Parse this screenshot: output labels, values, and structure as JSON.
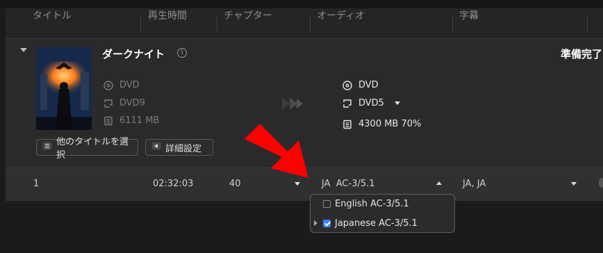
{
  "header": {
    "columns": [
      "タイトル",
      "再生時間",
      "チャプター",
      "オーディオ",
      "字幕"
    ]
  },
  "disc": {
    "title": "ダークナイト",
    "status": "準備完了",
    "source": {
      "type": "DVD",
      "format": "DVD9",
      "size": "6111 MB"
    },
    "target": {
      "type": "DVD",
      "format": "DVD5",
      "size": "4300 MB 70%"
    },
    "buttons": {
      "select_title": "他のタイトルを選択",
      "advanced": "詳細設定"
    }
  },
  "title_row": {
    "number": "1",
    "duration": "02:32:03",
    "chapters": "40",
    "audio": "JA  AC-3/5.1",
    "subtitle": "JA, JA"
  },
  "audio_dropdown": {
    "options": [
      {
        "label": "English AC-3/5.1",
        "checked": false
      },
      {
        "label": "Japanese AC-3/5.1",
        "checked": true
      }
    ]
  },
  "colors": {
    "accent": "#3b82f6",
    "annotation_arrow": "#ff0000"
  },
  "icons": {
    "disc": "disc-icon",
    "format": "format-icon",
    "size": "size-icon",
    "info": "info-icon",
    "transfer": "double-chevron-right-icon"
  }
}
